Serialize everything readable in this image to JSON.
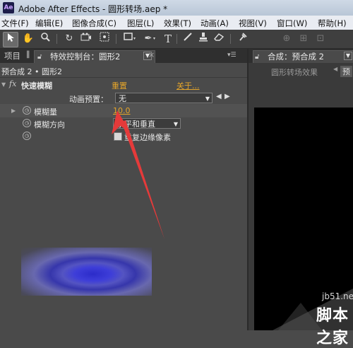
{
  "window": {
    "app_icon": "Ae",
    "title": "Adobe After Effects - 圆形转场.aep *"
  },
  "menu": [
    "文件(F)",
    "编辑(E)",
    "图像合成(C)",
    "图层(L)",
    "效果(T)",
    "动画(A)",
    "视图(V)",
    "窗口(W)",
    "帮助(H)"
  ],
  "toolbar": {
    "icons": [
      "selection-tool-icon",
      "hand-tool-icon",
      "zoom-tool-icon",
      "rotate-tool-icon",
      "camera-tool-icon",
      "pan-behind-tool-icon",
      "rectangle-tool-icon",
      "pen-tool-icon",
      "text-tool-icon",
      "brush-tool-icon",
      "clone-stamp-tool-icon",
      "eraser-tool-icon",
      "puppet-tool-icon"
    ],
    "text_tool_glyph": "T"
  },
  "left_tabs": {
    "project": "项目",
    "effect_controls": "特效控制台：圆形2",
    "close": "×"
  },
  "right_tabs": {
    "composition": "合成：预合成 2",
    "sub_tab": "圆形转场效果",
    "sub_tab2": "预"
  },
  "effect_panel": {
    "breadcrumb": "预合成 2 • 圆形2",
    "fx_badge": "fx",
    "effect_name": "快速模糊",
    "reset": "重置",
    "about": "关于...",
    "preset_label": "动画预置：",
    "preset_value": "无",
    "params": [
      {
        "name": "模糊量",
        "value": "10.0"
      },
      {
        "name": "模糊方向",
        "value": "水平和垂直"
      },
      {
        "name": "",
        "value": "重复边缘像素"
      }
    ]
  },
  "watermark": {
    "site": "jb51.net",
    "name": "脚本之家"
  },
  "colors": {
    "accent_orange": "#e5a52a",
    "arrow_red": "#e53a3a",
    "preview_blue": "#3535d0"
  }
}
